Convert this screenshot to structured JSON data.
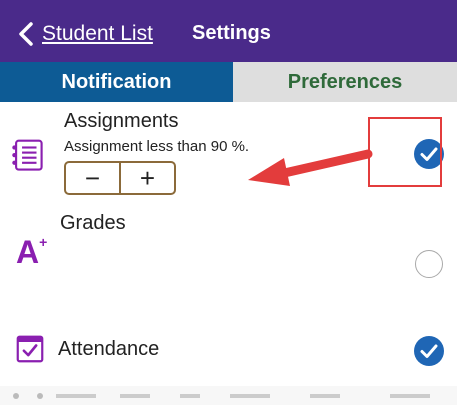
{
  "header": {
    "back_label": "Student List",
    "title": "Settings"
  },
  "tabs": [
    {
      "label": "Notification",
      "active": true
    },
    {
      "label": "Preferences",
      "active": false
    }
  ],
  "rows": [
    {
      "title": "Assignments",
      "subtitle": "Assignment less than 90 %.",
      "stepper": {
        "minus": "−",
        "plus": "+"
      },
      "checked": true,
      "icon": "checklist-icon"
    },
    {
      "title": "Grades",
      "checked": false,
      "icon": "a-plus-icon",
      "icon_text": "A",
      "icon_sup": "+"
    },
    {
      "title": "Attendance",
      "checked": true,
      "icon": "calendar-check-icon"
    }
  ],
  "colors": {
    "header_bg": "#4a2a8a",
    "tab_active_bg": "#0d5b95",
    "tab_inactive_bg": "#dedede",
    "tab_inactive_text": "#2f6a3a",
    "check_blue": "#1f66b5",
    "accent_purple": "#8a1fb0",
    "annotation_red": "#e33c3c"
  }
}
